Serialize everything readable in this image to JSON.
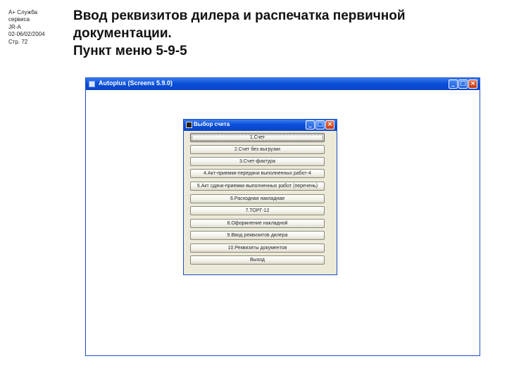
{
  "slide_meta": {
    "lines": [
      "А+ Служба",
      "сервиса",
      "JR-A",
      "02-06/02/2004",
      "Стр. 72"
    ]
  },
  "heading": {
    "lines": [
      "Ввод реквизитов дилера и распечатка первичной",
      "документации.",
      "Пункт меню 5-9-5"
    ]
  },
  "main_window": {
    "title": "Autoplus (Screens 5.9.0)",
    "icon": "app-icon",
    "controls": {
      "minimize": "_",
      "maximize": "□",
      "close": "×"
    }
  },
  "dialog": {
    "title": "Выбор счета",
    "controls": {
      "minimize": "_",
      "maximize": "□",
      "close": "×"
    },
    "buttons": [
      "1.Счет",
      "2.Счет без выгрузки",
      "3.Счет-фактура",
      "4.Акт-приемки-передачи выполненных работ-4",
      "5.Акт сдачи-приемки выполненных работ (перечень)",
      "6.Расходная накладная",
      "7.ТОРГ-12",
      "8.Оформление накладной",
      "9.Ввод реквизитов дилера",
      "10.Реквизиты документов",
      "Выход"
    ]
  }
}
